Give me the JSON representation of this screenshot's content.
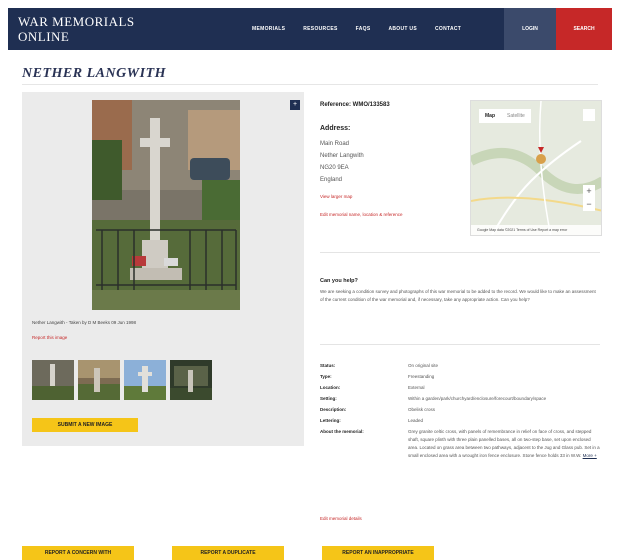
{
  "header": {
    "logo_line1": "WAR MEMORIALS",
    "logo_line2": "ONLINE",
    "nav": [
      "MEMORIALS",
      "RESOURCES",
      "FAQS",
      "ABOUT US",
      "CONTACT"
    ],
    "login": "LOGIN",
    "search": "SEARCH"
  },
  "page_title": "NETHER LANGWITH",
  "photo": {
    "caption": "Nether Langwith - Taken by D M Beeks 09 Jun 1998",
    "report_link": "Report this image",
    "thumbnails": 4,
    "submit_button": "SUBMIT A NEW IMAGE"
  },
  "reference": "Reference: WMO/133583",
  "address": {
    "label": "Address:",
    "lines": [
      "Main Road",
      "Nether Langwith",
      "NG20 9EA",
      "England"
    ],
    "view_map": "View larger map",
    "suggest": "Edit memorial name, location & reference"
  },
  "map": {
    "tab_map": "Map",
    "tab_satellite": "Satellite",
    "zoom_in": "+",
    "zoom_out": "−",
    "footer": "Google   Map data ©2021   Terms of Use   Report a map error"
  },
  "help": {
    "title": "Can you help?",
    "text": "We are seeking a condition survey and photographs of this war memorial to be added to the record. We would like to make an assessment of the current condition of the war memorial and, if necessary, take any appropriate action. Can you help?"
  },
  "details": [
    {
      "label": "Status:",
      "value": "On original site"
    },
    {
      "label": "Type:",
      "value": "Freestanding"
    },
    {
      "label": "Location:",
      "value": "External"
    },
    {
      "label": "Setting:",
      "value": "Within a garden/park/churchyard/enclosure/forecourt/boundary/space"
    },
    {
      "label": "Description:",
      "value": "Obelisk cross"
    },
    {
      "label": "Lettering:",
      "value": "Leaded"
    },
    {
      "label": "About the memorial:",
      "value": "Grey granite celtic cross, with panels of remembrance in relief on face of cross, and stepped shaft, square plinth with three plain panelled bases, all on two-step base, set upon enclosed area. Located on grass area between two pathways, adjacent to the Jug and Glass pub. Set in a small enclosed area with a wrought iron fence enclosure. Stone fence holds 33 in W.W.",
      "more": "More +"
    }
  ],
  "edit_link": "Edit memorial details",
  "bottom_buttons": [
    "REPORT A CONCERN WITH",
    "REPORT A DUPLICATE",
    "REPORT AN INAPPROPRIATE"
  ],
  "colors": {
    "navy": "#1f2f52",
    "red": "#c62828",
    "yellow": "#f5c518",
    "panel": "#ebebeb"
  }
}
